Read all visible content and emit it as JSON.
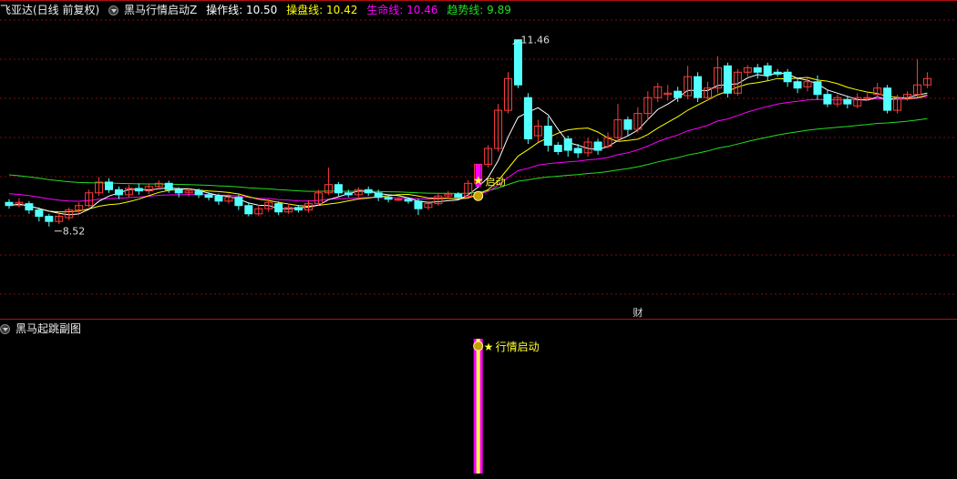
{
  "header": {
    "app_title": "飞亚达(日线 前复权)",
    "indicator_name": "黑马行情启动Z",
    "op_label": "操作线:",
    "op_value": "10.50",
    "pan_label": "操盘线:",
    "pan_value": "10.42",
    "life_label": "生命线:",
    "life_value": "10.46",
    "trend_label": "趋势线:",
    "trend_value": "9.89"
  },
  "sub": {
    "title": "黑马起跳副图",
    "signal_label": "行情启动"
  },
  "colors": {
    "up": "#ff3b3b",
    "down": "#54ffff",
    "grid": "#7a1010",
    "divider": "#b01010",
    "op": "#ffffff",
    "pan": "#ffff00",
    "life": "#ff00ff",
    "trend": "#22dd22",
    "signal": "#ffff33",
    "bar_outer": "#ff00ff",
    "bar_inner": "#ffff44"
  },
  "chart_data": {
    "type": "candlestick",
    "ylim": [
      8.0,
      11.8
    ],
    "annotations": {
      "high_label": "11.46",
      "high_value": 11.46,
      "high_index": 50,
      "low_label": "8.52",
      "low_value": 8.52,
      "low_index": 4,
      "start_label": "启动",
      "start_index": 47,
      "fin_label": "财",
      "fin_index": 63
    },
    "candles": [
      [
        8.9,
        8.85,
        8.95,
        8.8
      ],
      [
        8.85,
        8.9,
        8.97,
        8.82
      ],
      [
        8.88,
        8.78,
        8.92,
        8.72
      ],
      [
        8.78,
        8.68,
        8.82,
        8.6
      ],
      [
        8.68,
        8.6,
        8.72,
        8.52
      ],
      [
        8.6,
        8.68,
        8.74,
        8.56
      ],
      [
        8.66,
        8.78,
        8.82,
        8.62
      ],
      [
        8.78,
        8.85,
        8.9,
        8.72
      ],
      [
        8.85,
        9.05,
        9.1,
        8.82
      ],
      [
        9.05,
        9.22,
        9.3,
        9.0
      ],
      [
        9.22,
        9.1,
        9.28,
        9.05
      ],
      [
        9.1,
        9.02,
        9.15,
        8.95
      ],
      [
        9.02,
        9.12,
        9.18,
        8.98
      ],
      [
        9.12,
        9.08,
        9.2,
        9.02
      ],
      [
        9.08,
        9.15,
        9.2,
        9.03
      ],
      [
        9.15,
        9.2,
        9.25,
        9.1
      ],
      [
        9.2,
        9.1,
        9.24,
        9.05
      ],
      [
        9.1,
        9.05,
        9.14,
        8.98
      ],
      [
        9.05,
        9.08,
        9.12,
        9.0
      ],
      [
        9.08,
        9.02,
        9.12,
        8.97
      ],
      [
        9.02,
        8.98,
        9.06,
        8.93
      ],
      [
        9.0,
        8.92,
        9.04,
        8.86
      ],
      [
        8.92,
        8.98,
        9.03,
        8.88
      ],
      [
        8.98,
        8.85,
        9.02,
        8.78
      ],
      [
        8.85,
        8.72,
        8.9,
        8.68
      ],
      [
        8.72,
        8.8,
        8.86,
        8.68
      ],
      [
        8.8,
        8.9,
        8.95,
        8.75
      ],
      [
        8.88,
        8.75,
        8.92,
        8.7
      ],
      [
        8.75,
        8.82,
        8.88,
        8.72
      ],
      [
        8.82,
        8.78,
        8.86,
        8.74
      ],
      [
        8.78,
        8.88,
        8.94,
        8.74
      ],
      [
        8.88,
        9.05,
        9.1,
        8.85
      ],
      [
        9.05,
        9.18,
        9.45,
        9.02
      ],
      [
        9.18,
        9.05,
        9.22,
        9.0
      ],
      [
        9.05,
        9.02,
        9.1,
        8.98
      ],
      [
        9.02,
        9.1,
        9.14,
        8.98
      ],
      [
        9.1,
        9.05,
        9.15,
        9.0
      ],
      [
        9.05,
        8.98,
        9.1,
        8.92
      ],
      [
        8.98,
        8.95,
        9.0,
        8.9
      ],
      [
        8.95,
        8.95,
        8.98,
        8.92
      ],
      [
        8.95,
        8.92,
        8.98,
        8.88
      ],
      [
        8.92,
        8.8,
        8.96,
        8.7
      ],
      [
        8.82,
        8.88,
        8.92,
        8.78
      ],
      [
        8.88,
        9.0,
        9.05,
        8.85
      ],
      [
        9.0,
        9.03,
        9.08,
        8.95
      ],
      [
        9.03,
        8.98,
        9.06,
        8.94
      ],
      [
        9.0,
        9.2,
        9.25,
        8.98
      ],
      [
        9.2,
        9.5,
        9.5,
        9.15
      ],
      [
        9.5,
        9.75,
        9.8,
        9.45
      ],
      [
        9.75,
        10.35,
        10.45,
        9.7
      ],
      [
        10.35,
        10.85,
        10.95,
        10.3
      ],
      [
        11.46,
        10.75,
        11.46,
        10.7
      ],
      [
        10.55,
        9.9,
        10.62,
        9.82
      ],
      [
        9.95,
        10.1,
        10.2,
        9.85
      ],
      [
        10.1,
        9.8,
        10.25,
        9.7
      ],
      [
        9.8,
        9.7,
        9.85,
        9.65
      ],
      [
        9.9,
        9.72,
        9.95,
        9.62
      ],
      [
        9.75,
        9.68,
        9.82,
        9.6
      ],
      [
        9.68,
        9.85,
        9.92,
        9.62
      ],
      [
        9.85,
        9.72,
        9.9,
        9.65
      ],
      [
        9.78,
        9.92,
        10.0,
        9.75
      ],
      [
        9.92,
        10.2,
        10.45,
        9.85
      ],
      [
        10.2,
        10.05,
        10.25,
        9.95
      ],
      [
        10.05,
        10.3,
        10.4,
        10.0
      ],
      [
        10.3,
        10.55,
        10.65,
        10.2
      ],
      [
        10.55,
        10.72,
        10.78,
        10.48
      ],
      [
        10.6,
        10.62,
        10.75,
        10.5
      ],
      [
        10.65,
        10.55,
        10.72,
        10.48
      ],
      [
        10.58,
        10.88,
        11.05,
        10.52
      ],
      [
        10.88,
        10.55,
        10.95,
        10.48
      ],
      [
        10.55,
        10.7,
        10.8,
        10.5
      ],
      [
        10.7,
        11.02,
        11.2,
        10.62
      ],
      [
        11.05,
        10.62,
        11.1,
        10.55
      ],
      [
        10.62,
        10.95,
        11.0,
        10.58
      ],
      [
        10.95,
        11.02,
        11.06,
        10.88
      ],
      [
        11.02,
        10.95,
        11.08,
        10.85
      ],
      [
        11.05,
        10.9,
        11.1,
        10.82
      ],
      [
        10.95,
        10.92,
        11.0,
        10.88
      ],
      [
        10.95,
        10.8,
        11.0,
        10.72
      ],
      [
        10.8,
        10.7,
        10.85,
        10.62
      ],
      [
        10.72,
        10.8,
        10.86,
        10.65
      ],
      [
        10.8,
        10.6,
        10.9,
        10.52
      ],
      [
        10.6,
        10.45,
        10.68,
        10.4
      ],
      [
        10.45,
        10.55,
        10.6,
        10.4
      ],
      [
        10.52,
        10.45,
        10.58,
        10.38
      ],
      [
        10.42,
        10.55,
        10.62,
        10.38
      ],
      [
        10.55,
        10.55,
        10.62,
        10.5
      ],
      [
        10.6,
        10.7,
        10.78,
        10.55
      ],
      [
        10.7,
        10.35,
        10.75,
        10.3
      ],
      [
        10.35,
        10.55,
        10.6,
        10.3
      ],
      [
        10.55,
        10.6,
        10.65,
        10.5
      ],
      [
        10.6,
        10.75,
        11.15,
        10.55
      ],
      [
        10.75,
        10.85,
        10.95,
        10.7
      ]
    ]
  }
}
